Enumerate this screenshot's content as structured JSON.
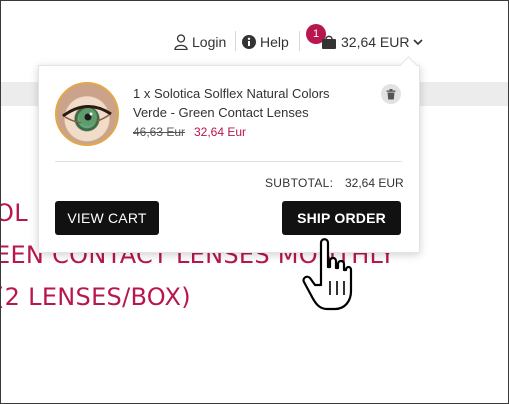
{
  "header": {
    "login_label": "Login",
    "help_label": "Help",
    "cart_count": "1",
    "cart_total": "32,64 EUR"
  },
  "page": {
    "title_lines": [
      "OL",
      "EEN CONTACT LENSES MONTHLY",
      " (2 LENSES/BOX)"
    ]
  },
  "cart_dropdown": {
    "item": {
      "name": "1 x Solotica Solflex Natural Colors Verde - Green Contact Lenses",
      "old_price": "46,63 Eur",
      "new_price": "32,64 Eur"
    },
    "subtotal_label": "SUBTOTAL:",
    "subtotal_value": "32,64 EUR",
    "view_cart_label": "VIEW CART",
    "ship_order_label": "SHIP ORDER"
  },
  "colors": {
    "accent": "#b8164f",
    "button_bg": "#111111"
  },
  "icons": [
    "user-icon",
    "info-icon",
    "shopping-bag-icon",
    "chevron-down-icon",
    "trash-icon",
    "pointer-hand-icon"
  ]
}
